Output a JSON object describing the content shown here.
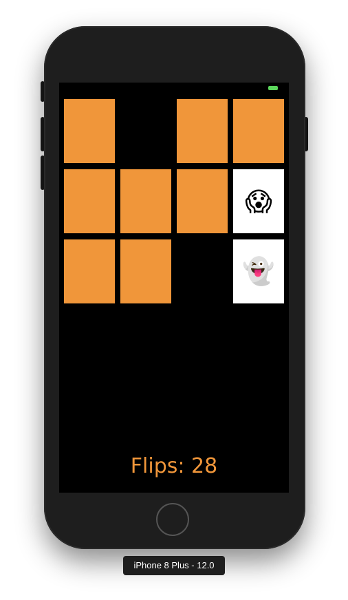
{
  "device": {
    "label": "iPhone 8 Plus - 12.0"
  },
  "game": {
    "flips_label": "Flips: 28",
    "card_back_color": "#f0963a",
    "card_face_color": "#ffffff",
    "grid": {
      "columns": 4,
      "rows": 3,
      "cards": [
        {
          "state": "face-down"
        },
        {
          "state": "matched"
        },
        {
          "state": "face-down"
        },
        {
          "state": "face-down"
        },
        {
          "state": "face-down"
        },
        {
          "state": "face-down"
        },
        {
          "state": "face-down"
        },
        {
          "state": "face-up",
          "emoji": "😱"
        },
        {
          "state": "face-down"
        },
        {
          "state": "face-down"
        },
        {
          "state": "matched"
        },
        {
          "state": "face-up",
          "emoji": "👻"
        }
      ]
    }
  },
  "status_bar": {
    "battery_color": "#5bd65b"
  }
}
